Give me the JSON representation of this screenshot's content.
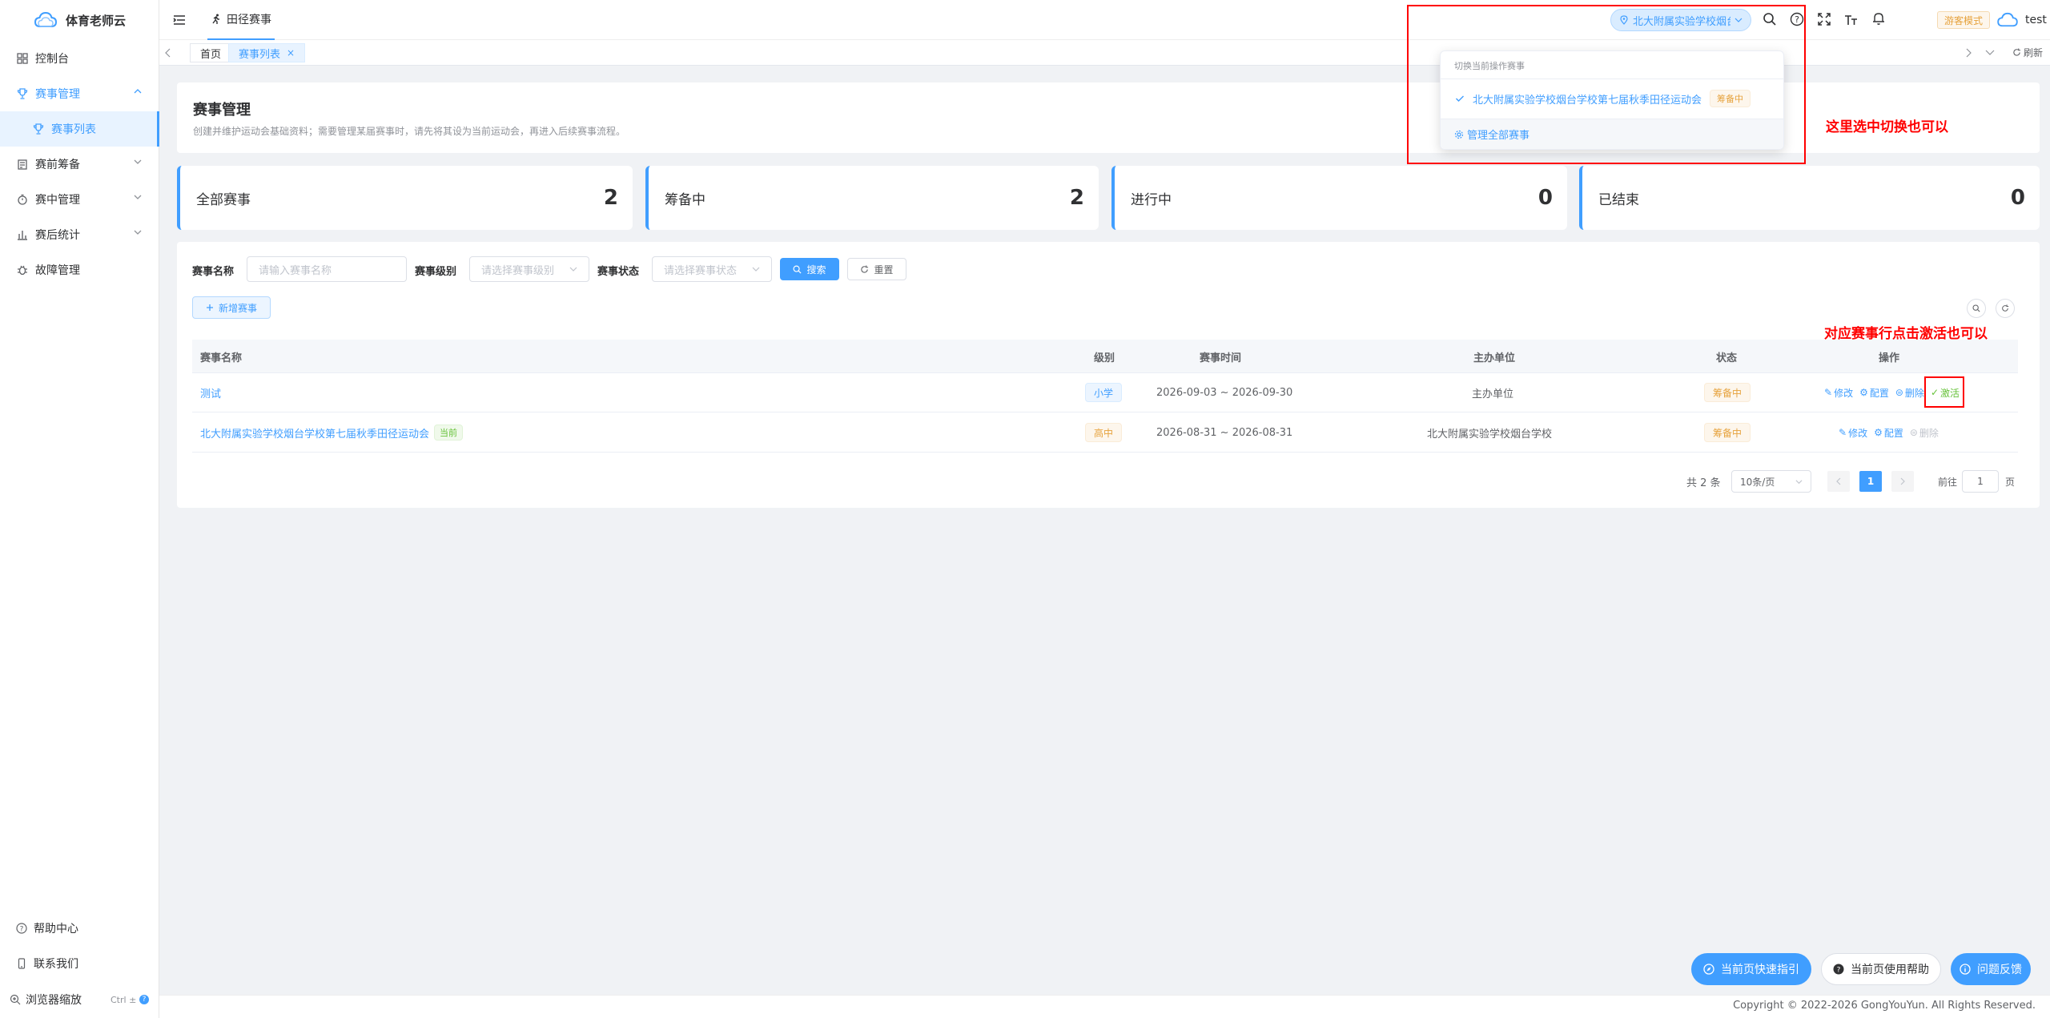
{
  "app": {
    "name": "体育老师云"
  },
  "sidebar": {
    "items": [
      {
        "label": "控制台",
        "icon": "dashboard-icon"
      },
      {
        "label": "赛事管理",
        "icon": "trophy-icon"
      },
      {
        "label": "赛事列表",
        "icon": "trophy-icon"
      },
      {
        "label": "赛前筹备",
        "icon": "clipboard-icon"
      },
      {
        "label": "赛中管理",
        "icon": "stopwatch-icon"
      },
      {
        "label": "赛后统计",
        "icon": "bar-chart-icon"
      },
      {
        "label": "故障管理",
        "icon": "bug-icon"
      }
    ],
    "bottom": {
      "help": "帮助中心",
      "contact": "联系我们",
      "zoom": "浏览器缩放",
      "zoom_hint": "Ctrl ±",
      "zoom_badge": "?"
    }
  },
  "header": {
    "module_title": "田径赛事",
    "event_selector": "北大附属实验学校烟台...",
    "mode_badge": "游客模式",
    "user": "test"
  },
  "tabs": {
    "home": "首页",
    "list": "赛事列表",
    "list_close": "×",
    "refresh": "刷新"
  },
  "dropdown": {
    "title": "切换当前操作赛事",
    "item_label": "北大附属实验学校烟台学校第七届秋季田径运动会",
    "item_status": "筹备中",
    "manage_link": "管理全部赛事"
  },
  "page": {
    "title": "赛事管理",
    "description": "创建并维护运动会基础资料；需要管理某届赛事时，请先将其设为当前运动会，再进入后续赛事流程。"
  },
  "stats": [
    {
      "label": "全部赛事",
      "value": "2"
    },
    {
      "label": "筹备中",
      "value": "2"
    },
    {
      "label": "进行中",
      "value": "0"
    },
    {
      "label": "已结束",
      "value": "0"
    }
  ],
  "filters": {
    "name_label": "赛事名称",
    "name_placeholder": "请输入赛事名称",
    "level_label": "赛事级别",
    "level_placeholder": "请选择赛事级别",
    "status_label": "赛事状态",
    "status_placeholder": "请选择赛事状态",
    "search": "搜索",
    "reset": "重置",
    "add": "新增赛事"
  },
  "table": {
    "headers": [
      "赛事名称",
      "级别",
      "赛事时间",
      "主办单位",
      "状态",
      "操作"
    ],
    "rows": [
      {
        "name": "测试",
        "current": "",
        "level": "小学",
        "time": "2026-09-03 ~ 2026-09-30",
        "host": "主办单位",
        "status": "筹备中",
        "ops": {
          "edit": "修改",
          "config": "配置",
          "delete": "删除",
          "activate": "激活"
        }
      },
      {
        "name": "北大附属实验学校烟台学校第七届秋季田径运动会",
        "current": "当前",
        "level": "高中",
        "time": "2026-08-31 ~ 2026-08-31",
        "host": "北大附属实验学校烟台学校",
        "status": "筹备中",
        "ops": {
          "edit": "修改",
          "config": "配置",
          "delete": "删除",
          "activate": ""
        }
      }
    ]
  },
  "pagination": {
    "total": "共 2 条",
    "page_size": "10条/页",
    "current": "1",
    "goto_prefix": "前往",
    "goto_value": "1",
    "goto_suffix": "页"
  },
  "annotations": {
    "note1": "这里选中切换也可以",
    "note2": "对应赛事行点击激活也可以"
  },
  "floating": {
    "guide": "当前页快速指引",
    "help": "当前页使用帮助",
    "feedback": "问题反馈"
  },
  "footer": {
    "copyright": "Copyright © 2022-2026 GongYouYun. All Rights Reserved."
  },
  "colors": {
    "primary": "#409eff",
    "warning": "#e6a23c",
    "danger": "#f56c6c",
    "annotation": "#ff0000"
  }
}
